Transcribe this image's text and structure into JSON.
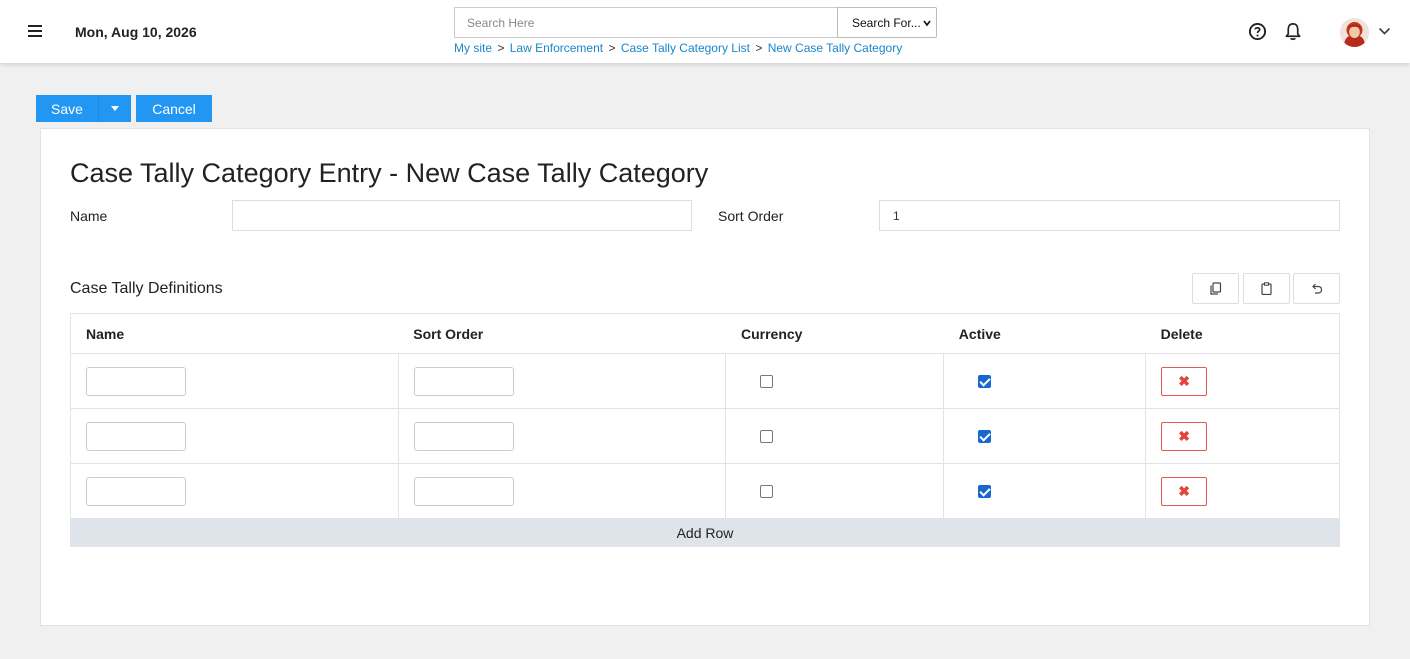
{
  "header": {
    "date": "Mon, Aug 10, 2026",
    "search_placeholder": "Search Here",
    "search_select": "Search For...",
    "breadcrumb": [
      "My site",
      "Law Enforcement",
      "Case Tally Category List",
      "New Case Tally Category"
    ],
    "breadcrumb_sep": ">"
  },
  "toolbar": {
    "save_label": "Save",
    "cancel_label": "Cancel"
  },
  "form": {
    "title": "Case Tally Category Entry - New Case Tally Category",
    "name_label": "Name",
    "name_value": "",
    "sort_order_label": "Sort Order",
    "sort_order_value": "1"
  },
  "definitions": {
    "title": "Case Tally Definitions",
    "columns": [
      "Name",
      "Sort Order",
      "Currency",
      "Active",
      "Delete"
    ],
    "rows": [
      {
        "name": "",
        "sort_order": "",
        "currency": false,
        "active": true
      },
      {
        "name": "",
        "sort_order": "",
        "currency": false,
        "active": true
      },
      {
        "name": "",
        "sort_order": "",
        "currency": false,
        "active": true
      }
    ],
    "add_row_label": "Add Row"
  },
  "icons": {
    "menu": "menu-icon",
    "help": "help-icon",
    "bell": "bell-icon",
    "copy": "copy-icon",
    "paste": "clipboard-icon",
    "undo": "undo-icon",
    "delete": "close-icon"
  },
  "colors": {
    "accent": "#2196f3",
    "link": "#1a86c9",
    "delete": "#e0463a",
    "checkbox": "#1769d0"
  }
}
